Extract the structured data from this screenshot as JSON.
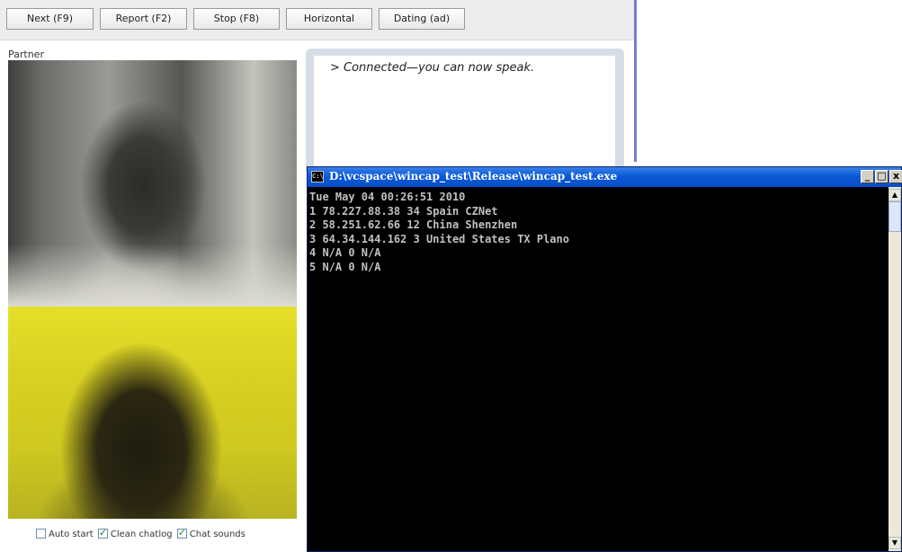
{
  "toolbar": {
    "buttons": [
      {
        "label": "Next (F9)"
      },
      {
        "label": "Report (F2)"
      },
      {
        "label": "Stop (F8)"
      },
      {
        "label": "Horizontal"
      },
      {
        "label": "Dating (ad)"
      }
    ]
  },
  "partner": {
    "label": "Partner"
  },
  "chat": {
    "message": "> Connected—you can now speak."
  },
  "options": [
    {
      "label": "Auto start",
      "checked": false
    },
    {
      "label": "Clean chatlog",
      "checked": true
    },
    {
      "label": "Chat sounds",
      "checked": true
    }
  ],
  "console": {
    "title": "D:\\vcspace\\wincap_test\\Release\\wincap_test.exe",
    "icon": "console-app-icon",
    "lines": [
      "Tue May 04 00:26:51 2010",
      "1 78.227.88.38 34 Spain CZNet",
      "2 58.251.62.66 12 China Shenzhen",
      "3 64.34.144.162 3 United States TX Plano",
      "4 N/A 0 N/A",
      "5 N/A 0 N/A"
    ],
    "window_buttons": {
      "minimize": "_",
      "maximize": "□",
      "close": "x"
    }
  },
  "colors": {
    "toolbar_divider": "#6f7fd0",
    "console_bg": "#000000",
    "console_text": "#c0c0c0",
    "titlebar": "#0a5ad8",
    "checkmark": "#1a8a1a"
  }
}
